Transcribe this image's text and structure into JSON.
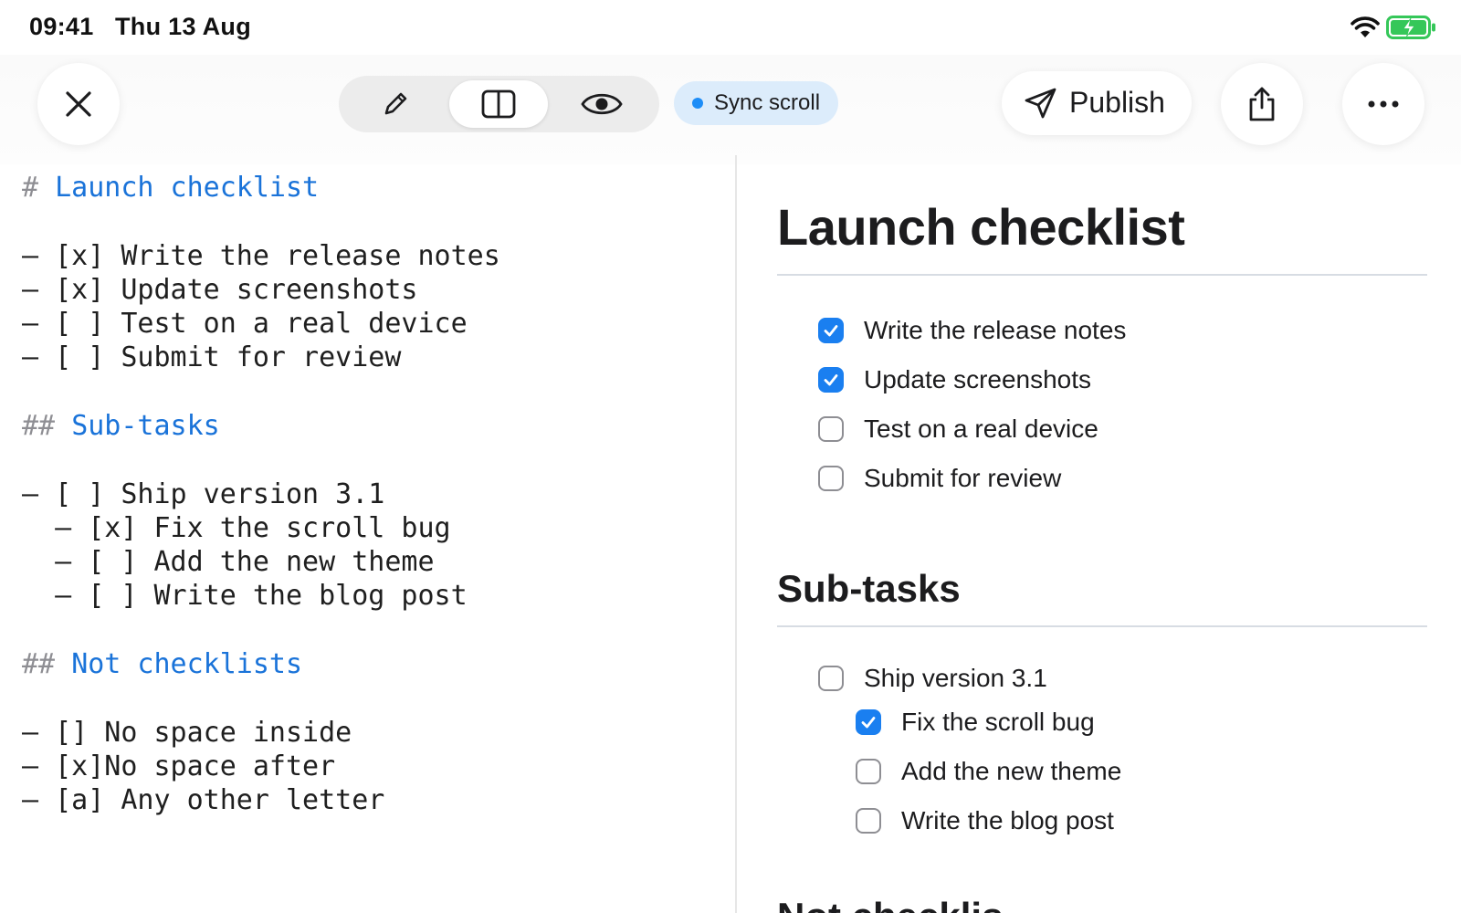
{
  "status": {
    "time": "09:41",
    "date": "Thu 13 Aug"
  },
  "toolbar": {
    "modes": [
      "edit",
      "split",
      "preview"
    ],
    "active_mode": "split",
    "sync_label": "Sync scroll",
    "publish_label": "Publish",
    "accent": "#1a73d9"
  },
  "editor": {
    "lines": [
      {
        "hash": "#",
        "text": "Launch checklist"
      },
      {
        "text": "– [x] Write the release notes"
      },
      {
        "text": "– [x] Update screenshots"
      },
      {
        "text": "– [ ] Test on a real device"
      },
      {
        "text": "– [ ] Submit for review"
      },
      {
        "hash": "##",
        "text": "Sub-tasks"
      },
      {
        "text": "– [ ] Ship version 3.1"
      },
      {
        "text": "  – [x] Fix the scroll bug"
      },
      {
        "text": "  – [ ] Add the new theme"
      },
      {
        "text": "  – [ ] Write the blog post"
      },
      {
        "hash": "##",
        "text": "Not checklists"
      },
      {
        "text": "– [] No space inside"
      },
      {
        "text": "– [x]No space after"
      },
      {
        "text": "– [a] Any other letter"
      }
    ]
  },
  "preview": {
    "title": "Launch checklist",
    "tasks": [
      {
        "label": "Write the release notes",
        "checked": true
      },
      {
        "label": "Update screenshots",
        "checked": true
      },
      {
        "label": "Test on a real device",
        "checked": false
      },
      {
        "label": "Submit for review",
        "checked": false
      }
    ],
    "subtasks_heading": "Sub-tasks",
    "subtasks": [
      {
        "label": "Ship version 3.1",
        "checked": false
      },
      {
        "label": "Fix the scroll bug",
        "checked": true
      },
      {
        "label": "Add the new theme",
        "checked": false
      },
      {
        "label": "Write the blog post",
        "checked": false
      }
    ],
    "next_heading_partial": "Not checklis"
  }
}
